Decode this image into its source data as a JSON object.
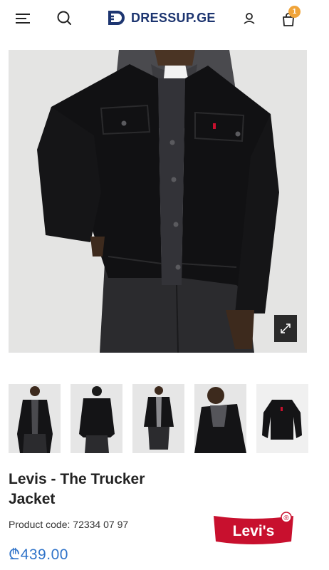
{
  "header": {
    "logo_text": "DRESSUP.GE",
    "cart_count": "1"
  },
  "icons": {
    "menu": "menu-icon",
    "search": "search-icon",
    "account": "user-icon",
    "cart": "shopping-bag-icon",
    "zoom": "expand-icon"
  },
  "gallery": {
    "thumbnail_count": 5
  },
  "product": {
    "title": "Levis - The Trucker Jacket",
    "code_label": "Product code:",
    "code_value": "72334 07 97",
    "price": "₾439.00",
    "brand_logo_text": "Levi's",
    "brand_logo_mark": "®"
  },
  "colors": {
    "brand_navy": "#1d3570",
    "badge_orange": "#f0a43a",
    "price_blue": "#2f73c9",
    "levis_red": "#c8102e"
  }
}
